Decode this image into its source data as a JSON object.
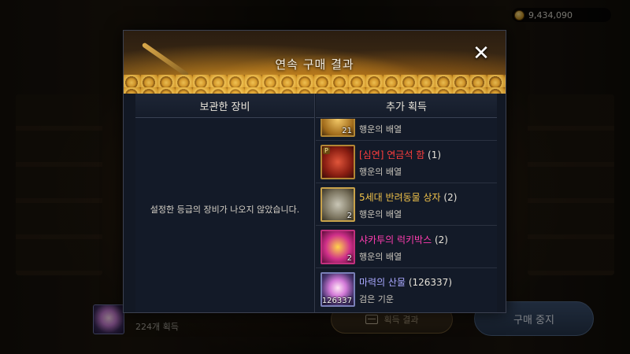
{
  "gold": {
    "amount": "9,434,090",
    "icon": "coin-icon"
  },
  "modal": {
    "title": "연속 구매 결과",
    "close_label": "✕",
    "left_column": {
      "header": "보관한 장비",
      "empty_message": "설정한 등급의 장비가 나오지 않았습니다."
    },
    "right_column": {
      "header": "추가 획득",
      "items": [
        {
          "name": "",
          "qty": "",
          "name_color": "#e6e2d8",
          "sub": "행운의 배열",
          "count": "21",
          "thumb": "gold-item-icon"
        },
        {
          "name": "[심연] 연금석 함",
          "qty": " (1)",
          "name_color": "#ff3d3d",
          "sub": "행운의 배열",
          "count": "",
          "thumb": "alchemy-stone-chest-icon",
          "badge": "P"
        },
        {
          "name": "5세대 반려동물 상자",
          "qty": " (2)",
          "name_color": "#f0c24a",
          "sub": "행운의 배열",
          "count": "2",
          "thumb": "pet-box-icon"
        },
        {
          "name": "샤카투의 럭키박스",
          "qty": " (2)",
          "name_color": "#ff3db0",
          "sub": "행운의 배열",
          "count": "2",
          "thumb": "lucky-box-icon"
        },
        {
          "name": "마력의 산물",
          "qty": " (126337)",
          "name_color": "#a9a8ff",
          "sub": "검은 기운",
          "count": "126337",
          "thumb": "magic-orb-icon"
        }
      ]
    }
  },
  "bottom": {
    "acquired_count": "224개 획득",
    "mid_button_label": "획득 결과",
    "stop_button_label": "구매 중지"
  }
}
